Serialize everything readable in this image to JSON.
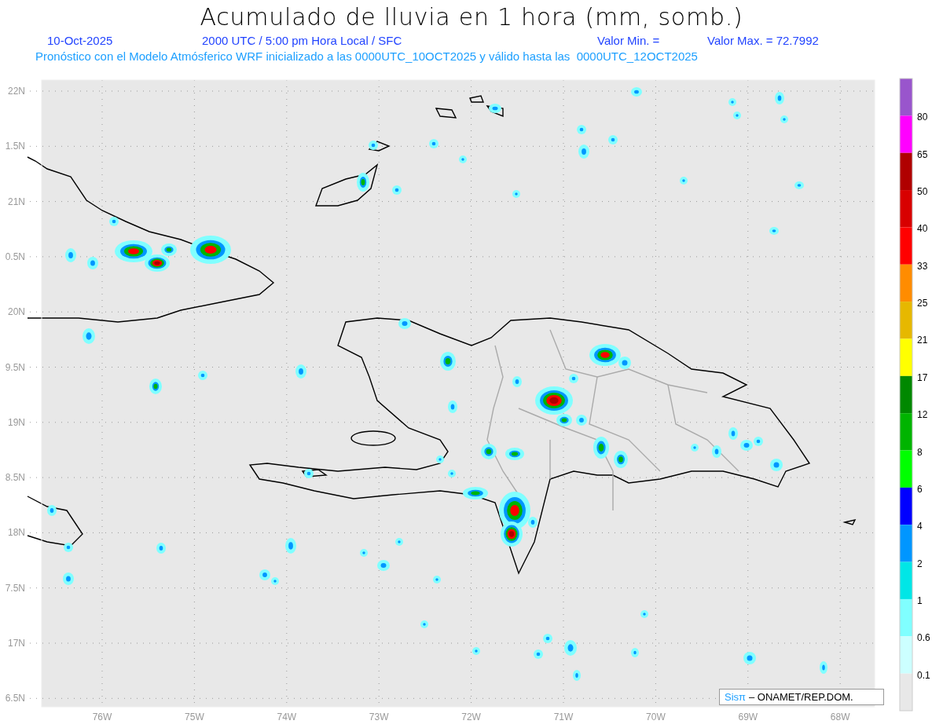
{
  "title": "Acumulado de lluvia en 1 hora (mm, somb.)",
  "info": {
    "date": "10-Oct-2025",
    "time": "2000 UTC / 5:00 pm Hora Local / SFC",
    "min_label": "Valor Min. =",
    "max_label": "Valor Max. = 72.7992"
  },
  "subtitle": "Pronóstico con el Modelo Atmósferico WRF inicializado a las 0000UTC_10OCT2025 y válido hasta las  0000UTC_12OCT2025",
  "map": {
    "lat_labels": [
      "22N",
      "1.5N",
      "21N",
      "0.5N",
      "20N",
      "9.5N",
      "19N",
      "8.5N",
      "18N",
      "7.5N",
      "17N",
      "6.5N"
    ],
    "lon_labels": [
      "76W",
      "75W",
      "74W",
      "73W",
      "72W",
      "71W",
      "70W",
      "69W",
      "68W"
    ]
  },
  "legend": [
    {
      "color": "#9955cc"
    },
    {
      "color": "#ff00ff",
      "label": "80"
    },
    {
      "color": "#b00000",
      "label": "65"
    },
    {
      "color": "#d80000",
      "label": "50"
    },
    {
      "color": "#ff0000",
      "label": "40"
    },
    {
      "color": "#ff8c00",
      "label": "33"
    },
    {
      "color": "#e6b800",
      "label": "25"
    },
    {
      "color": "#ffff00",
      "label": "21"
    },
    {
      "color": "#008800",
      "label": "17"
    },
    {
      "color": "#00b400",
      "label": "12"
    },
    {
      "color": "#00ff00",
      "label": "8"
    },
    {
      "color": "#0000ff",
      "label": "6"
    },
    {
      "color": "#0096ff",
      "label": "4"
    },
    {
      "color": "#00e6e6",
      "label": "2"
    },
    {
      "color": "#80ffff",
      "label": "1"
    },
    {
      "color": "#ccffff",
      "label": "0.6"
    },
    {
      "color": "#e8e8e8",
      "label": "0.1"
    }
  ],
  "credit": {
    "logo": "Sisπ",
    "text": "– ONAMET/REP.DOM."
  }
}
